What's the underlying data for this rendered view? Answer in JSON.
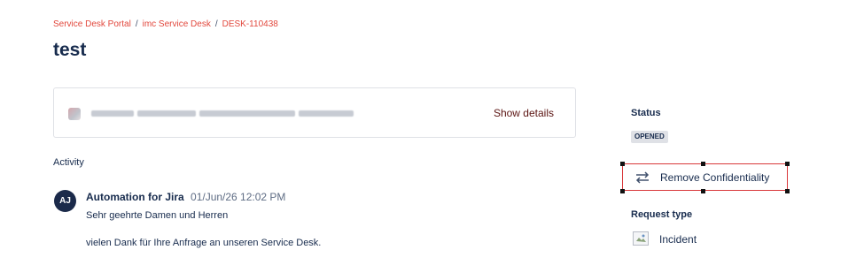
{
  "breadcrumb": {
    "items": [
      "Service Desk Portal",
      "imc Service Desk",
      "DESK-110438"
    ],
    "separator": "/"
  },
  "page": {
    "title": "test"
  },
  "summary": {
    "show_details_label": "Show details"
  },
  "activity": {
    "heading": "Activity",
    "comment": {
      "avatar_initials": "AJ",
      "author": "Automation for Jira",
      "timestamp": "01/Jun/26 12:02 PM",
      "line1": "Sehr geehrte Damen und Herren",
      "line2": "vielen Dank für Ihre Anfrage an unseren Service Desk."
    }
  },
  "sidebar": {
    "status_label": "Status",
    "status_value": "OPENED",
    "confidentiality_button": "Remove Confidentiality",
    "request_type_label": "Request type",
    "request_type_value": "Incident"
  },
  "colors": {
    "breadcrumb": "#e2483d",
    "show_details": "#5b1412",
    "selection_border": "#d9383a",
    "avatar_bg": "#1b2a4a"
  }
}
